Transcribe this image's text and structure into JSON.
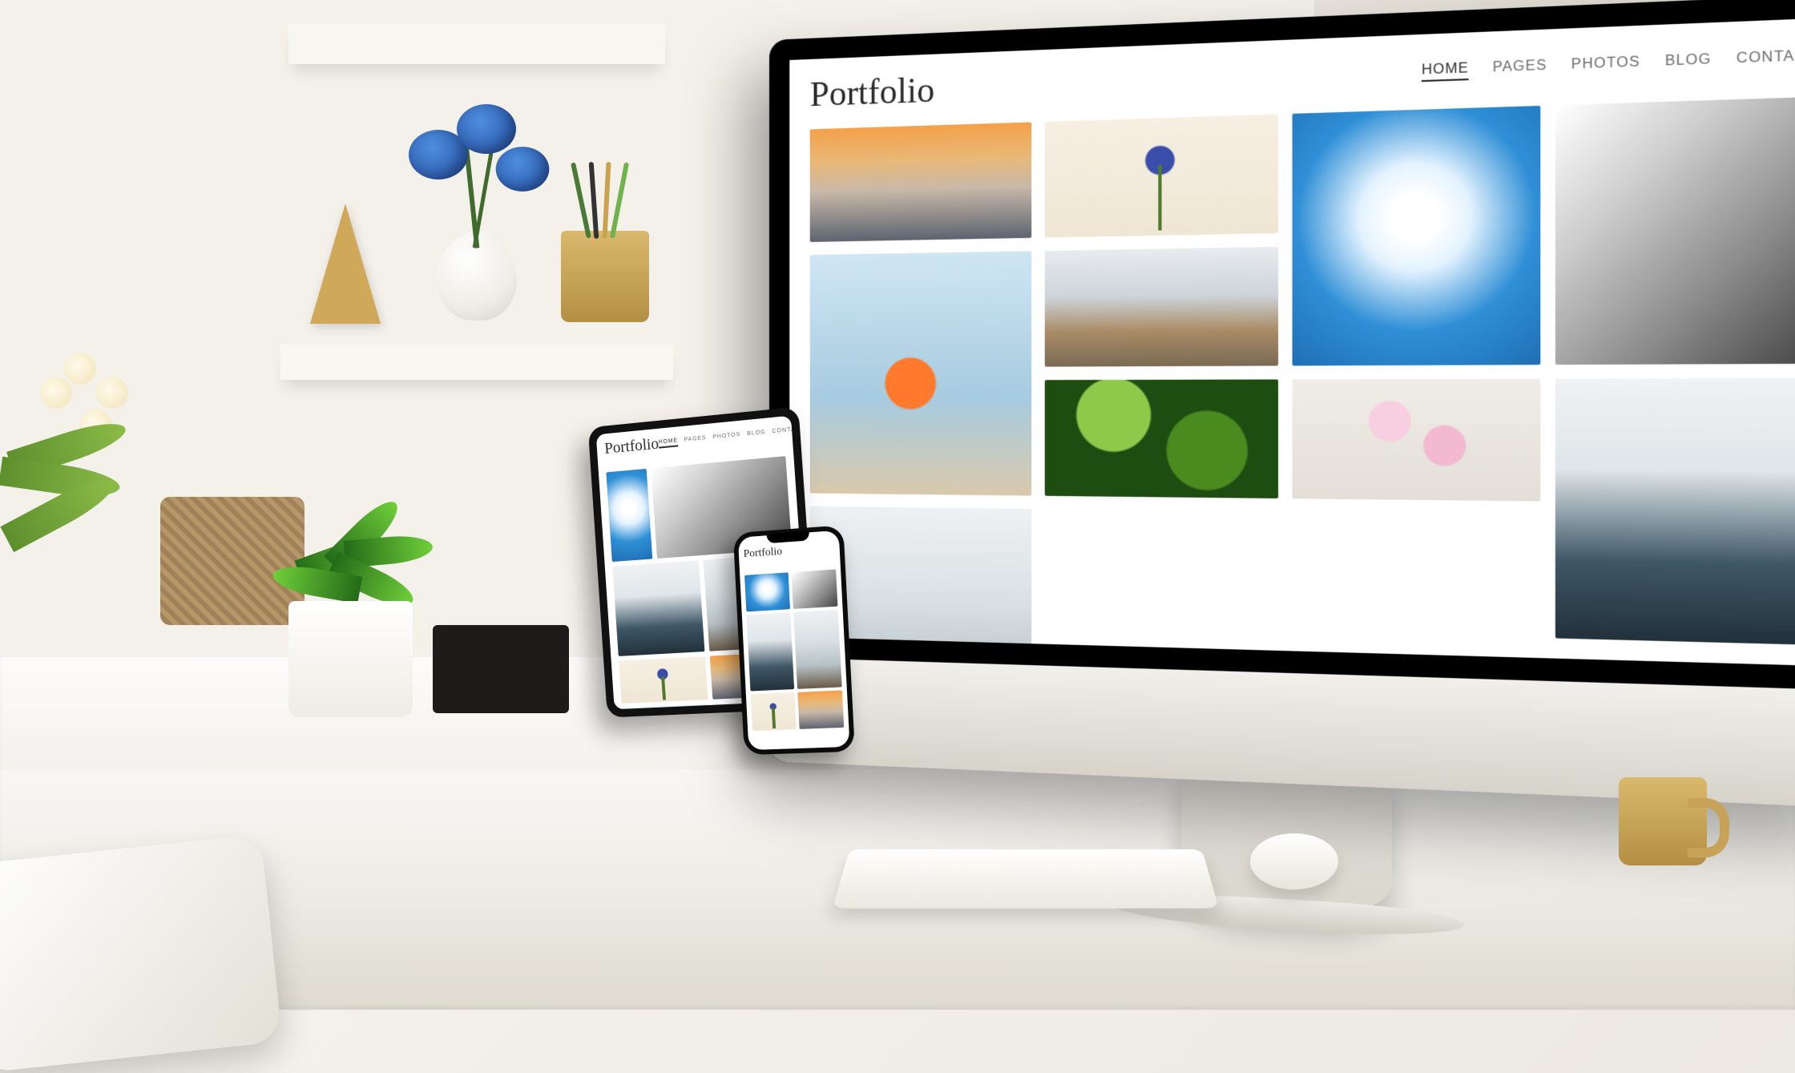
{
  "site": {
    "logo": "Portfolio",
    "nav": [
      {
        "label": "HOME",
        "active": true
      },
      {
        "label": "PAGES",
        "active": false
      },
      {
        "label": "PHOTOS",
        "active": false
      },
      {
        "label": "BLOG",
        "active": false
      },
      {
        "label": "CONTACT",
        "active": false
      }
    ],
    "tiles": [
      {
        "name": "sunset-harbor"
      },
      {
        "name": "grape-hyacinth"
      },
      {
        "name": "jellyfish"
      },
      {
        "name": "steel-bridge"
      },
      {
        "name": "starfish"
      },
      {
        "name": "coastal-city"
      },
      {
        "name": "foggy-mountain"
      },
      {
        "name": "sea-wall"
      },
      {
        "name": "green-leaves"
      },
      {
        "name": "cherry-blossom"
      }
    ]
  }
}
